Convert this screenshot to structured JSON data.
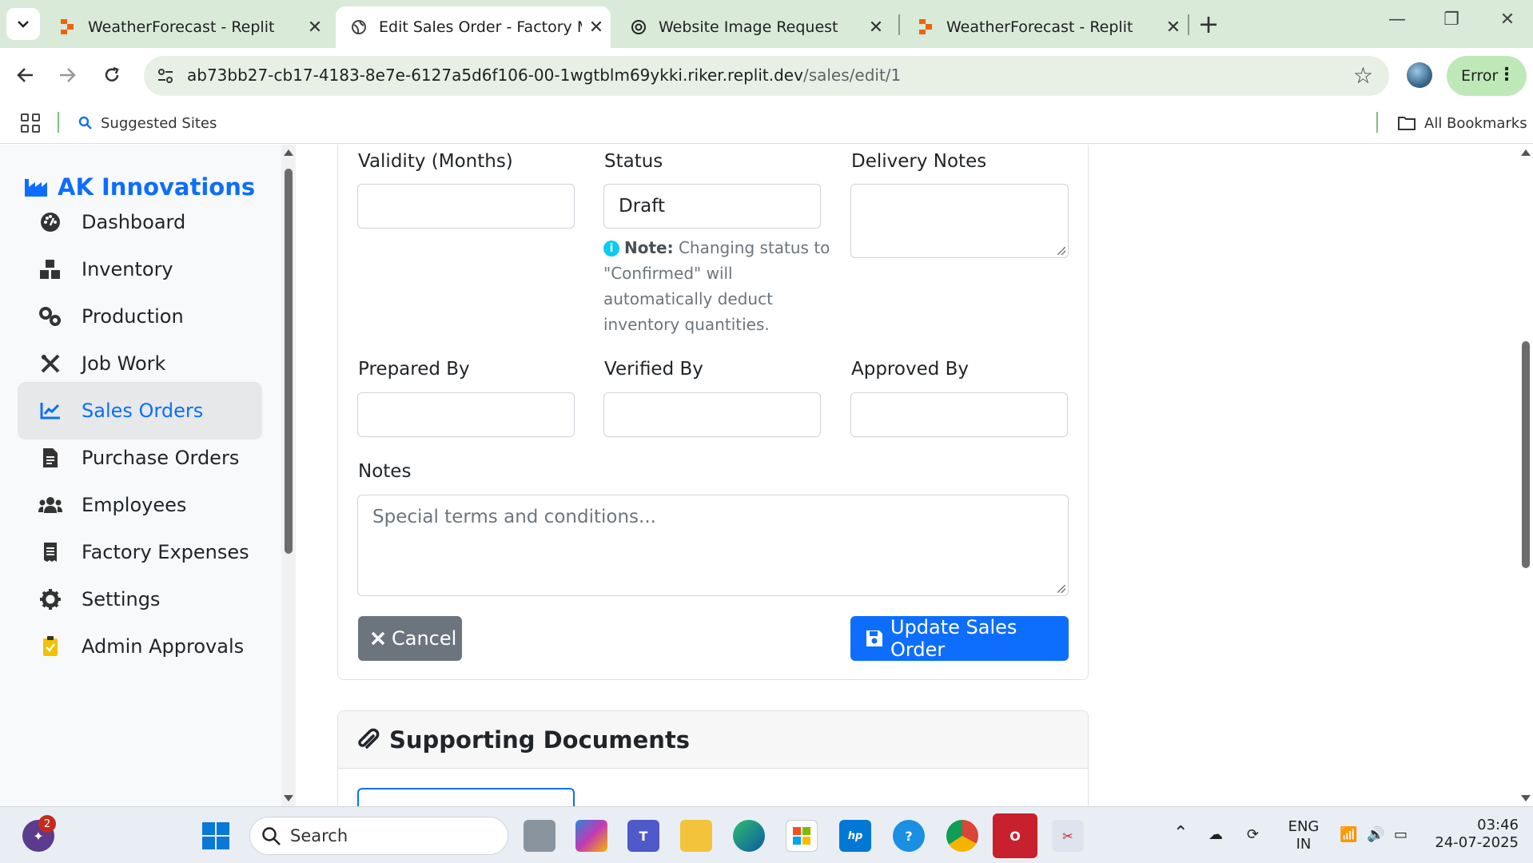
{
  "browser": {
    "tabs": [
      {
        "title": "WeatherForecast - Replit",
        "icon": "replit-icon",
        "active": false
      },
      {
        "title": "Edit Sales Order - Factory Mana",
        "icon": "globe-icon",
        "active": true
      },
      {
        "title": "Website Image Request",
        "icon": "openai-icon",
        "active": false
      },
      {
        "title": "WeatherForecast - Replit",
        "icon": "replit-icon",
        "active": false
      }
    ],
    "url_host": "ab73bb27-cb17-4183-8e7e-6127a5d6f106-00-1wgtblm69ykki.riker.replit.dev",
    "url_path": "/sales/edit/1",
    "error_label": "Error",
    "bookmarks": {
      "suggested": "Suggested Sites",
      "all": "All Bookmarks"
    }
  },
  "sidebar": {
    "brand": "AK Innovations",
    "items": [
      {
        "label": "Dashboard",
        "icon": "dashboard-icon"
      },
      {
        "label": "Inventory",
        "icon": "boxes-icon"
      },
      {
        "label": "Production",
        "icon": "gears-icon"
      },
      {
        "label": "Job Work",
        "icon": "tools-icon"
      },
      {
        "label": "Sales Orders",
        "icon": "chart-line-icon",
        "active": true
      },
      {
        "label": "Purchase Orders",
        "icon": "invoice-icon"
      },
      {
        "label": "Employees",
        "icon": "users-icon"
      },
      {
        "label": "Factory Expenses",
        "icon": "receipt-icon"
      },
      {
        "label": "Settings",
        "icon": "gear-icon"
      },
      {
        "label": "Admin Approvals",
        "icon": "clipboard-check-icon"
      }
    ]
  },
  "form": {
    "validity_label": "Validity (Months)",
    "validity_value": "",
    "status_label": "Status",
    "status_value": "Draft",
    "delivery_notes_label": "Delivery Notes",
    "delivery_notes_value": "",
    "status_note_bold": "Note:",
    "status_note_text": "Changing status to \"Confirmed\" will automatically deduct inventory quantities.",
    "prepared_by_label": "Prepared By",
    "verified_by_label": "Verified By",
    "approved_by_label": "Approved By",
    "notes_label": "Notes",
    "notes_placeholder": "Special terms and conditions...",
    "cancel_label": "Cancel",
    "update_label": "Update Sales Order"
  },
  "documents": {
    "title": "Supporting Documents"
  },
  "taskbar": {
    "search_label": "Search",
    "notification_count": "2",
    "lang_top": "ENG",
    "lang_bottom": "IN",
    "time": "03:46",
    "date": "24-07-2025"
  },
  "colors": {
    "primary": "#0d6efd",
    "secondary": "#6c757d",
    "chrome_green": "#d9ead9"
  }
}
